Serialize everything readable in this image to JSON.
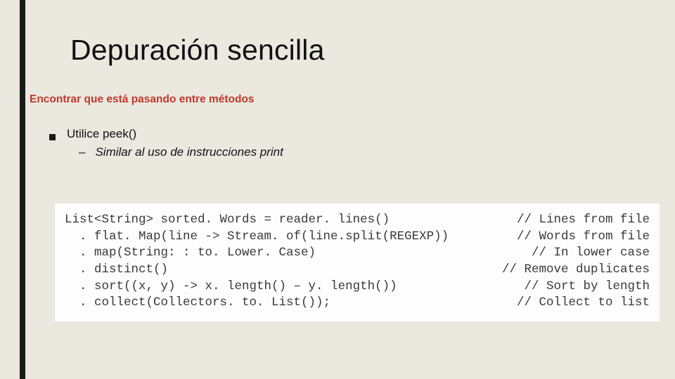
{
  "title": "Depuración sencilla",
  "subtitle": "Encontrar que está pasando entre métodos",
  "bullet": "Utilice peek()",
  "subbullet": "Similar al uso de instrucciones print",
  "code": [
    {
      "left": "List<String> sorted. Words = reader. lines()",
      "comment": "// Lines from file"
    },
    {
      "left": "  . flat. Map(line -> Stream. of(line.split(REGEXP))",
      "comment": "// Words from file"
    },
    {
      "left": "  . map(String: : to. Lower. Case)",
      "comment": "// In lower case"
    },
    {
      "left": "  . distinct()",
      "comment": "// Remove duplicates"
    },
    {
      "left": "  . sort((x, y) -> x. length() – y. length())",
      "comment": "// Sort by length"
    },
    {
      "left": "  . collect(Collectors. to. List());",
      "comment": "// Collect to list"
    }
  ]
}
